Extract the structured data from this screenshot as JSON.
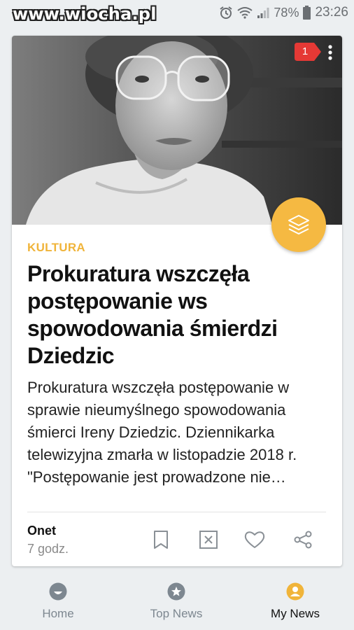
{
  "statusbar": {
    "watermark": "www.wiocha.pl",
    "battery": "78%",
    "time": "23:26",
    "icons": [
      "alarm-icon",
      "wifi-icon",
      "signal-icon",
      "battery-icon"
    ]
  },
  "card": {
    "badge_count": "1",
    "category": "KULTURA",
    "headline": "Prokuratura wszczęła postępowanie ws spowodowania śmierdzi Dziedzic",
    "summary": "Prokuratura wszczęła postępowanie w sprawie nieumyślnego spowodowania śmierci Ireny Dziedzic. Dziennikarka telewizyjna zmarła w listopadzie 2018 r. \"Postępowanie jest prowadzone nie…",
    "source": "Onet",
    "time_ago": "7 godz.",
    "accent_color": "#f0b43a",
    "badge_color": "#e53935"
  },
  "nav": {
    "items": [
      {
        "label": "Home",
        "icon": "smile-icon"
      },
      {
        "label": "Top News",
        "icon": "star-icon"
      },
      {
        "label": "My News",
        "icon": "person-icon"
      }
    ],
    "active": "My News"
  }
}
